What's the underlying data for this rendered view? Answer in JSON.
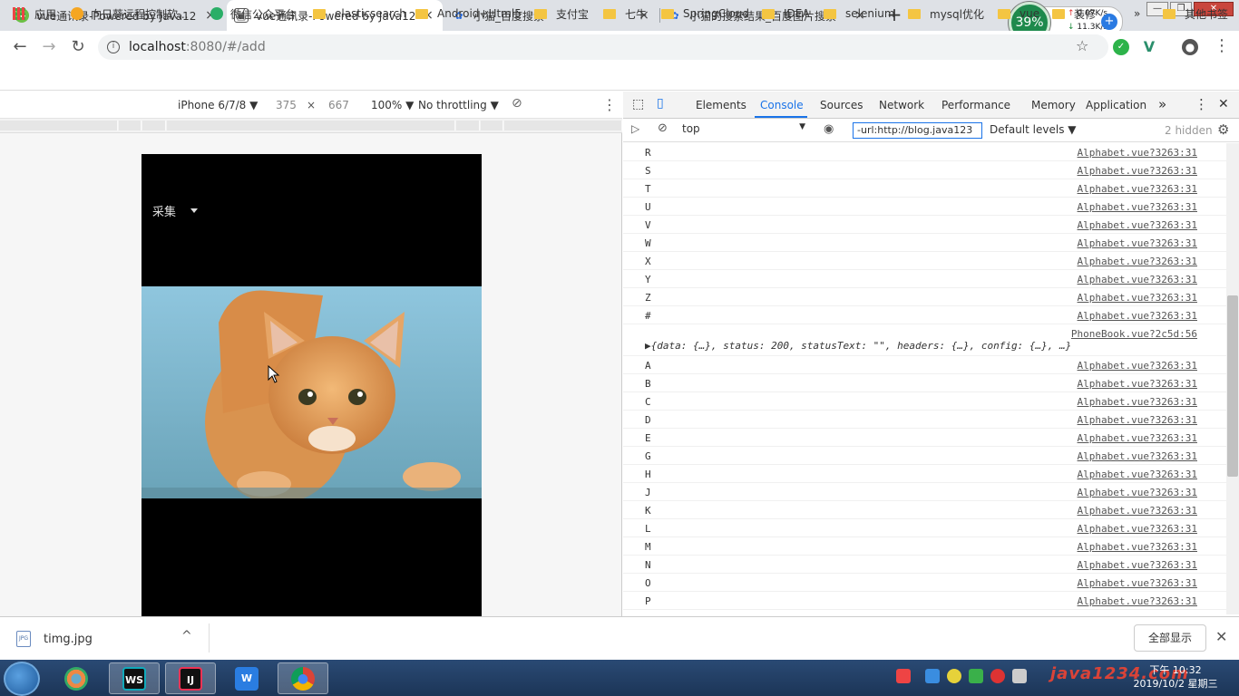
{
  "tabs": [
    {
      "title": "vue通讯录-Powered by Java12",
      "close": "×"
    },
    {
      "title": "vue通讯录-Powered by Java12",
      "close": "×"
    },
    {
      "title": "小猫_百度搜索",
      "close": "×"
    },
    {
      "title": "小猫的搜索结果_百度图片搜索",
      "close": "×"
    }
  ],
  "new_tab": "+",
  "net": {
    "percent": "39%",
    "up": "0.07K/s",
    "down": "11.3K/s",
    "plus": "+"
  },
  "window": {
    "minimize": "—",
    "restore": "❐",
    "close": "✕"
  },
  "address": {
    "host": "localhost",
    "rest": ":8080/#/add",
    "info": "i"
  },
  "nav": {
    "back": "←",
    "forward": "→",
    "reload": "↻",
    "star": "☆",
    "menu": "⋮"
  },
  "bookmarks": [
    "应用",
    "向日葵远程控制软...",
    "微信公众平台",
    "elasticsearch",
    "Android+Html5",
    "支付宝",
    "七牛",
    "SpringCloud",
    "IDEA",
    "selenium",
    "mysql优化",
    "vue",
    "装修"
  ],
  "bookmarks_more": "»",
  "bookmarks_other": "其他书签",
  "device": {
    "model": "iPhone 6/7/8 ▼",
    "width": "375",
    "times": "×",
    "height": "667",
    "zoom": "100% ▼",
    "throttle": "No throttling ▼"
  },
  "phone": {
    "select_label": "采集"
  },
  "devtools": {
    "tabs": [
      "Elements",
      "Console",
      "Sources",
      "Network",
      "Performance",
      "Memory",
      "Application"
    ],
    "more": "»",
    "kebab": "⋮",
    "close": "✕",
    "context": "top",
    "filter": "-url:http://blog.java123",
    "levels": "Default levels ▼",
    "hidden": "2 hidden"
  },
  "console_rows": [
    {
      "msg": "R",
      "src": "Alphabet.vue?3263:31"
    },
    {
      "msg": "S",
      "src": "Alphabet.vue?3263:31"
    },
    {
      "msg": "T",
      "src": "Alphabet.vue?3263:31"
    },
    {
      "msg": "U",
      "src": "Alphabet.vue?3263:31"
    },
    {
      "msg": "V",
      "src": "Alphabet.vue?3263:31"
    },
    {
      "msg": "W",
      "src": "Alphabet.vue?3263:31"
    },
    {
      "msg": "X",
      "src": "Alphabet.vue?3263:31"
    },
    {
      "msg": "Y",
      "src": "Alphabet.vue?3263:31"
    },
    {
      "msg": "Z",
      "src": "Alphabet.vue?3263:31"
    },
    {
      "msg": "#",
      "src": "Alphabet.vue?3263:31"
    },
    {
      "msg": "",
      "src": "PhoneBook.vue?2c5d:56"
    },
    {
      "msg": "▶{data: {…}, status: 200, statusText: \"\", headers: {…}, config: {…}, …}",
      "src": ""
    },
    {
      "msg": "A",
      "src": "Alphabet.vue?3263:31"
    },
    {
      "msg": "B",
      "src": "Alphabet.vue?3263:31"
    },
    {
      "msg": "C",
      "src": "Alphabet.vue?3263:31"
    },
    {
      "msg": "D",
      "src": "Alphabet.vue?3263:31"
    },
    {
      "msg": "E",
      "src": "Alphabet.vue?3263:31"
    },
    {
      "msg": "G",
      "src": "Alphabet.vue?3263:31"
    },
    {
      "msg": "H",
      "src": "Alphabet.vue?3263:31"
    },
    {
      "msg": "J",
      "src": "Alphabet.vue?3263:31"
    },
    {
      "msg": "K",
      "src": "Alphabet.vue?3263:31"
    },
    {
      "msg": "L",
      "src": "Alphabet.vue?3263:31"
    },
    {
      "msg": "M",
      "src": "Alphabet.vue?3263:31"
    },
    {
      "msg": "N",
      "src": "Alphabet.vue?3263:31"
    },
    {
      "msg": "O",
      "src": "Alphabet.vue?3263:31"
    },
    {
      "msg": "P",
      "src": "Alphabet.vue?3263:31"
    }
  ],
  "download": {
    "file": "timg.jpg",
    "type": "JPG",
    "caret": "^",
    "show_all": "全部显示",
    "close": "✕"
  },
  "taskbar": {
    "apps": [
      "WS",
      "IJ",
      "W",
      "●"
    ],
    "time": "下午 10:32",
    "date": "2019/10/2 星期三",
    "watermark": "java1234.com"
  },
  "colors": {
    "accent": "#1a73e8",
    "taskbar": "#1c3557"
  }
}
